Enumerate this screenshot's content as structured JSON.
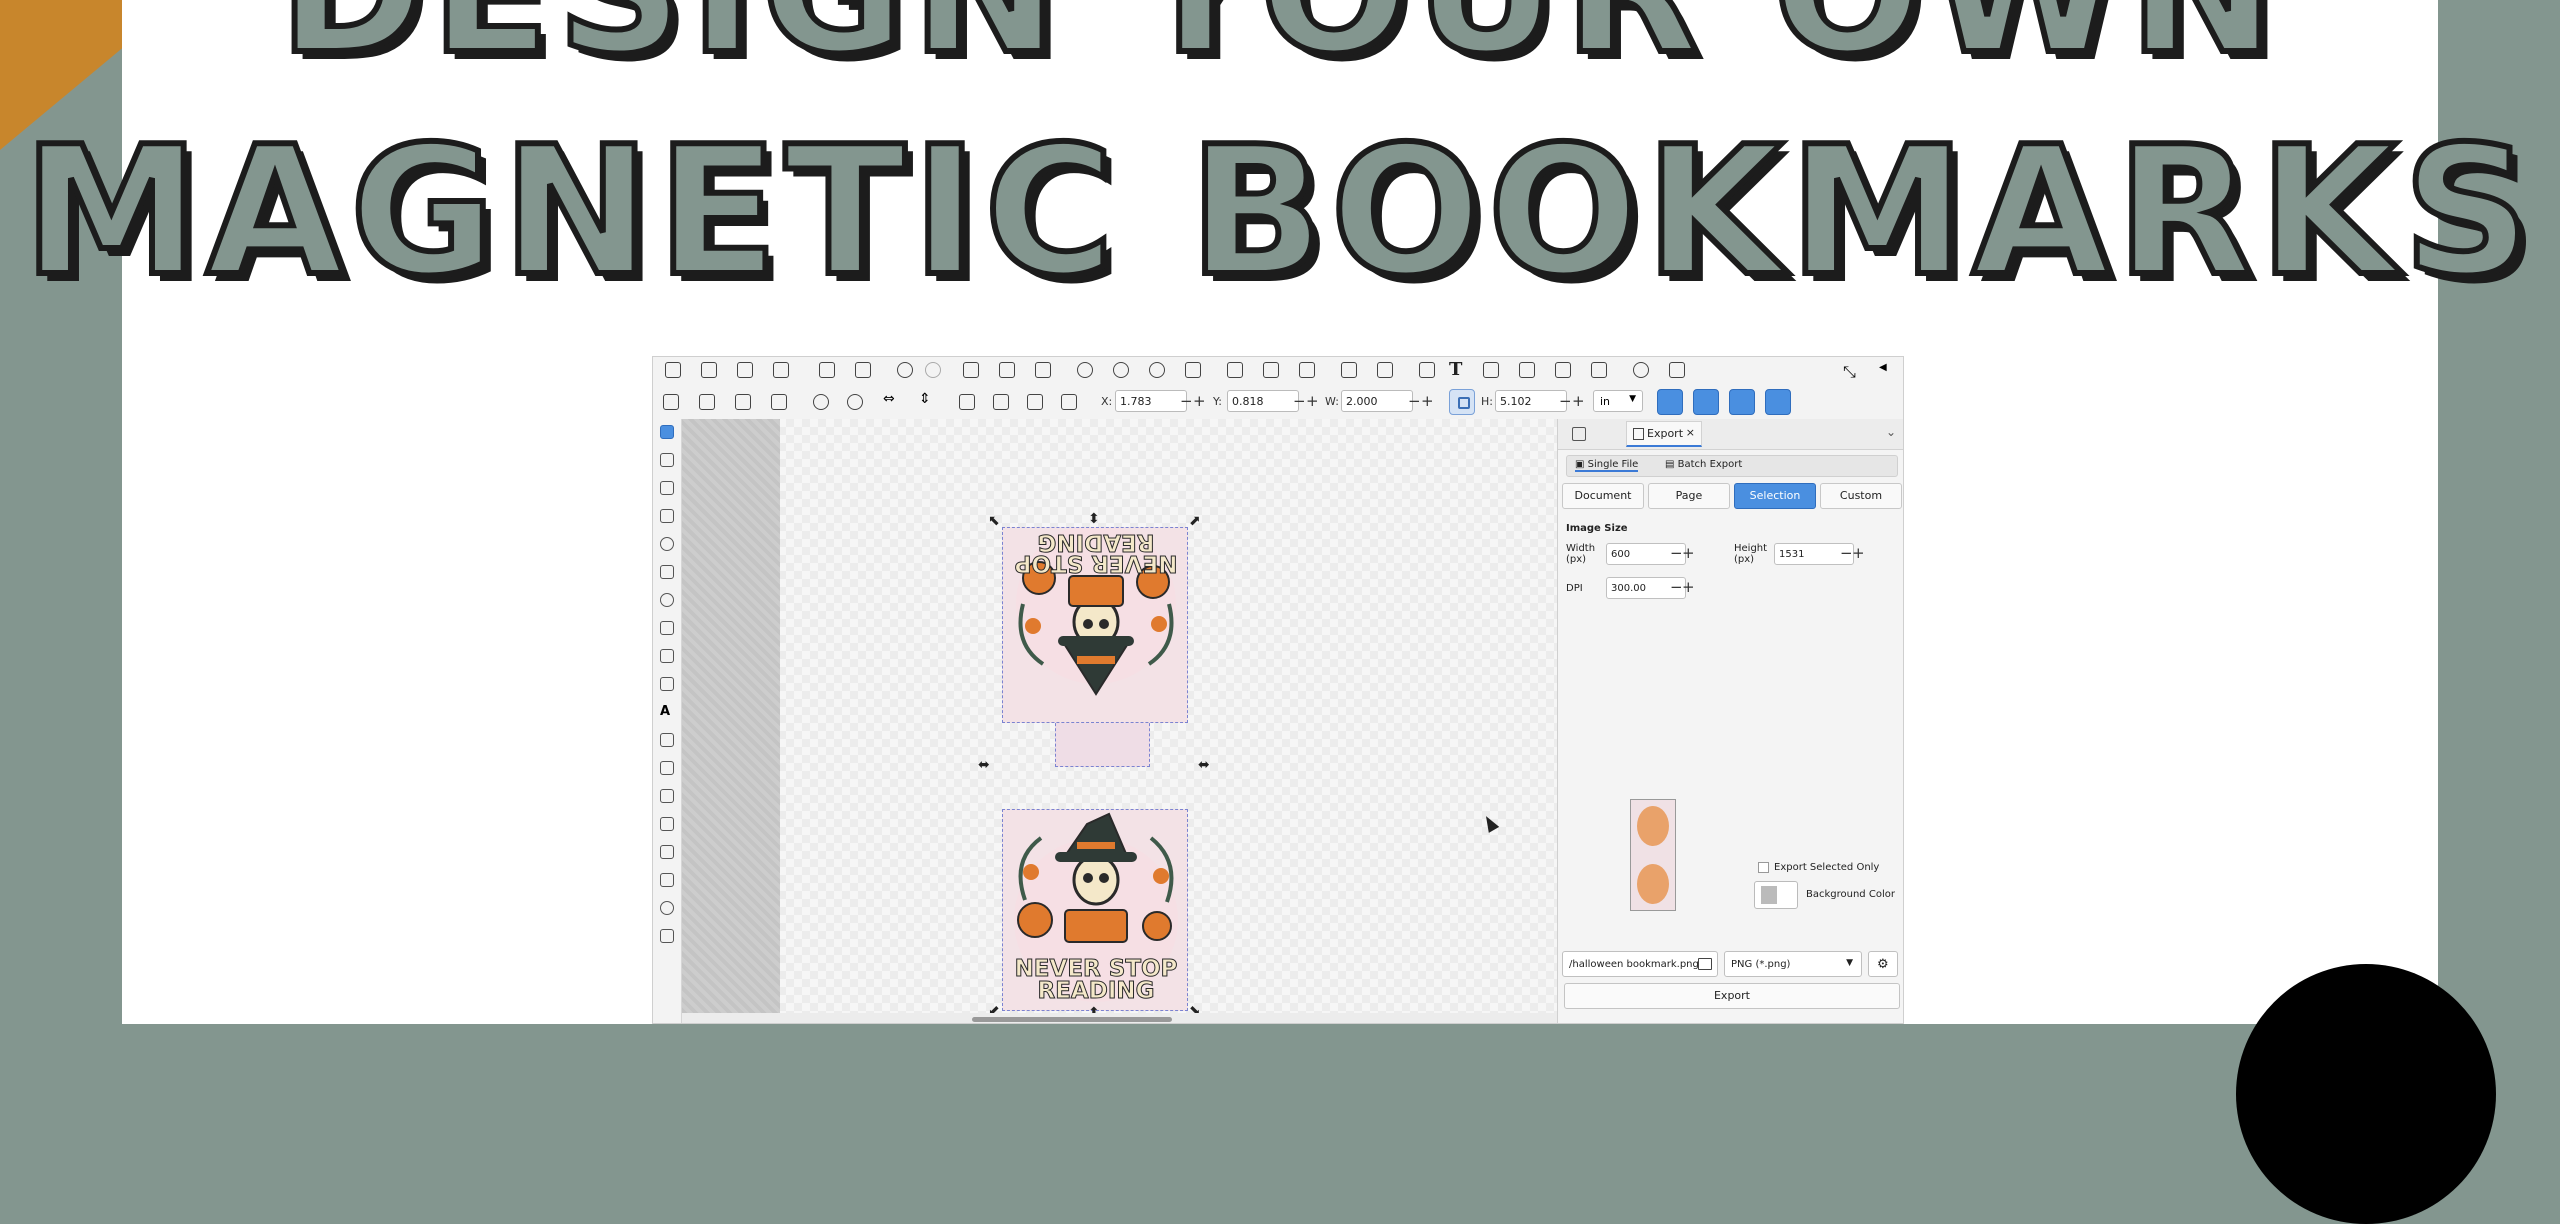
{
  "headline": {
    "line1": "DESIGN YOUR OWN",
    "line2": "MAGNETIC BOOKMARKS"
  },
  "toolbar": {
    "text_tool_glyph": "T",
    "x_label": "X:",
    "x_value": "1.783",
    "y_label": "Y:",
    "y_value": "0.818",
    "w_label": "W:",
    "w_value": "2.000",
    "h_label": "H:",
    "h_value": "5.102",
    "unit": "in",
    "stepper_minus": "−",
    "stepper_plus": "+"
  },
  "artwork": {
    "top_text": [
      "NEVER STOP",
      "READING"
    ],
    "bottom_text": [
      "NEVER STOP",
      "READING"
    ],
    "colors": {
      "pink": "#f3e2e6",
      "orange": "#e07a2e",
      "cream": "#f4e8c9",
      "dark": "#2a2a2a"
    }
  },
  "export_panel": {
    "tab_label": "Export",
    "single_file_label": "Single File",
    "batch_export_label": "Batch Export",
    "segments": [
      "Document",
      "Page",
      "Selection",
      "Custom"
    ],
    "active_segment": "Selection",
    "image_size_label": "Image Size",
    "width_label": "Width (px)",
    "width_value": "600",
    "height_label": "Height (px)",
    "height_value": "1531",
    "dpi_label": "DPI",
    "dpi_value": "300.00",
    "export_selected_only_label": "Export Selected Only",
    "background_color_label": "Background Color",
    "filename": "/halloween bookmark.png",
    "format": "PNG (*.png)",
    "export_button": "Export"
  },
  "colors": {
    "accent_blue": "#4a8fe0",
    "sage": "#83968f",
    "corner_gold": "#c8862c"
  }
}
